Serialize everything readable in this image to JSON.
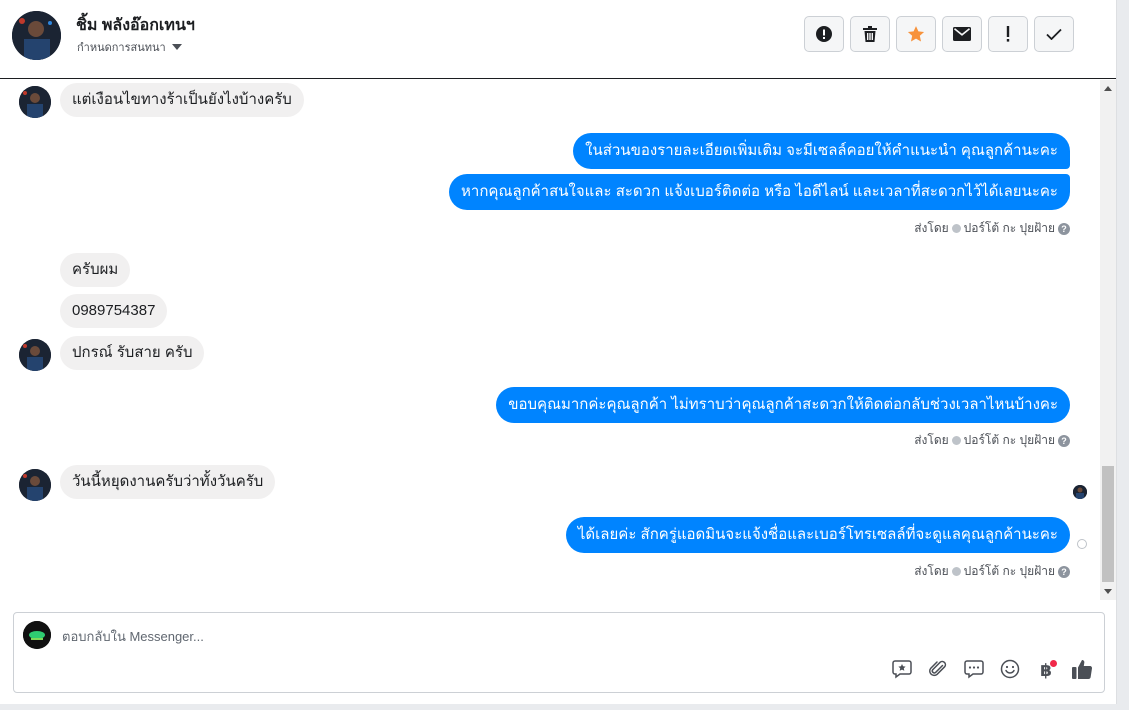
{
  "header": {
    "name": "ชิ้ม พลังอ๊อกเทนฯ",
    "assign_label": "กำหนดการสนทนา"
  },
  "toolbar": {
    "buttons": [
      {
        "icon": "alert-circle-icon"
      },
      {
        "icon": "trash-icon"
      },
      {
        "icon": "star-icon"
      },
      {
        "icon": "envelope-icon"
      },
      {
        "icon": "exclamation-icon"
      },
      {
        "icon": "check-icon"
      }
    ]
  },
  "messages": [
    {
      "dir": "in",
      "text": "แต่เงือนไขทางร้าเป็นยังไงบ้างครับ"
    },
    {
      "dir": "out",
      "text": "ในส่วนของรายละเอียดเพิ่มเติม จะมีเซลล์คอยให้คำแนะนำ คุณลูกค้านะคะ"
    },
    {
      "dir": "out",
      "text": "หากคุณลูกค้าสนใจและ สะดวก แจ้งเบอร์ติดต่อ หรือ ไอดีไลน์ และเวลาที่สะดวกไว้ได้เลยนะคะ"
    },
    {
      "dir": "in",
      "text": "ครับผม"
    },
    {
      "dir": "in",
      "text": "0989754387"
    },
    {
      "dir": "in",
      "text": "ปกรณ์ รับสาย ครับ"
    },
    {
      "dir": "out",
      "text": "ขอบคุณมากค่ะคุณลูกค้า ไม่ทราบว่าคุณลูกค้าสะดวกให้ติดต่อกลับช่วงเวลาไหนบ้างคะ"
    },
    {
      "dir": "in",
      "text": "วันนี้หยุดงานครับว่าทั้งวันครับ"
    },
    {
      "dir": "out",
      "text": "ได้เลยค่ะ สักครู่แอดมินจะแจ้งชื่อและเบอร์โทรเซลล์ที่จะดูแลคุณลูกค้านะคะ"
    }
  ],
  "sent_by": {
    "prefix": "ส่งโดย",
    "name": "ปอร์โต้ กะ ปุยฝ้าย"
  },
  "composer": {
    "placeholder": "ตอบกลับใน Messenger...",
    "baht_symbol": "฿"
  },
  "colors": {
    "outgoing_bubble": "#0084ff",
    "incoming_bubble": "#f1f0f0",
    "star": "#f7923b",
    "notification_dot": "#f02849"
  }
}
